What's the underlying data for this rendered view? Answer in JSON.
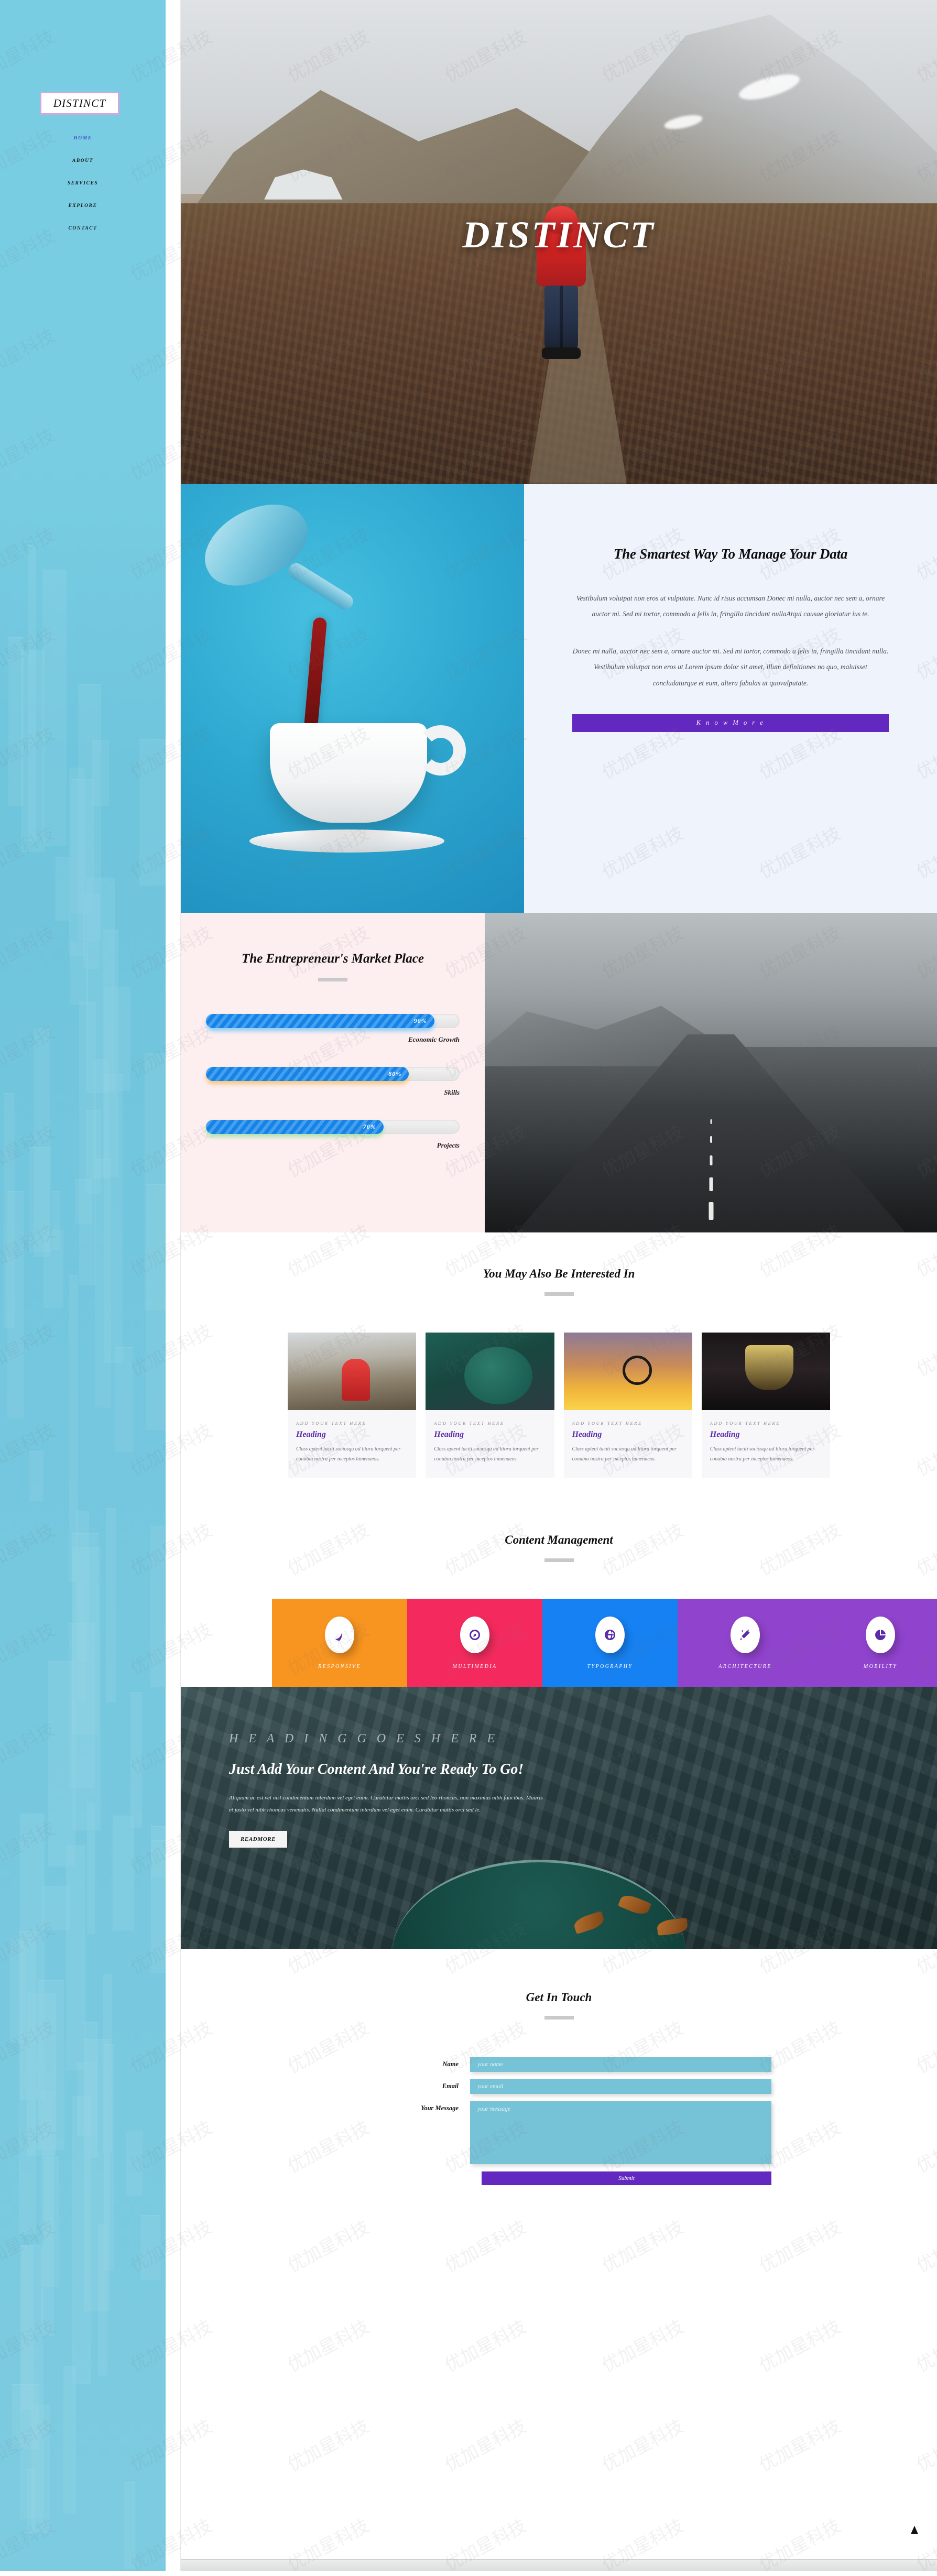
{
  "sidebar": {
    "logo": "DISTINCT",
    "nav": [
      {
        "label": "HOME",
        "active": true
      },
      {
        "label": "ABOUT",
        "active": false
      },
      {
        "label": "SERVICES",
        "active": false
      },
      {
        "label": "EXPLORE",
        "active": false
      },
      {
        "label": "CONTACT",
        "active": false
      }
    ],
    "bg_color": "#78cde2"
  },
  "hero": {
    "title": "DISTINCT"
  },
  "section_data": {
    "heading": "The Smartest Way To Manage Your Data",
    "paragraph1": "Vestibulum volutpat non eros ut vulputate. Nunc id risus accumsan Donec mi nulla, auctor nec sem a, ornare auctor mi. Sed mi tortor, commodo a felis in, fringilla tincidunt nullaAtqui causae gloriatur ius te.",
    "paragraph2": "Donec mi nulla, auctor nec sem a, ornare auctor mi. Sed mi tortor, commodo a felis in, fringilla tincidunt nulla. Vestibulum volutpat non eros ut Lorem ipsum dolor sit amet, illum definitiones no quo, maluisset concludaturque et eum, altera fabulas ut quovulputate.",
    "button": "K n o w   M o r e",
    "button_color": "#6328c0"
  },
  "market": {
    "heading": "The Entrepreneur's Market Place",
    "bars": [
      {
        "label": "Economic Growth",
        "value": "90%",
        "percent": 90,
        "glow": "#7ec8f5"
      },
      {
        "label": "Skills",
        "value": "80%",
        "percent": 80,
        "glow": "#f5c06a"
      },
      {
        "label": "Projects",
        "value": "70%",
        "percent": 70,
        "glow": "#9fe2a2"
      }
    ],
    "bar_color": "#1484e8",
    "bg_color": "#fdeef0"
  },
  "interested": {
    "heading": "You May Also Be Interested In",
    "cards": [
      {
        "eyebrow": "ADD YOUR TEXT HERE",
        "title": "Heading",
        "body": "Class aptent taciti sociosqu ad litora torquent per conubia nostra per inceptos himenaeos."
      },
      {
        "eyebrow": "ADD YOUR TEXT HERE",
        "title": "Heading",
        "body": "Class aptent taciti sociosqu ad litora torquent per conubia nostra per inceptos himenaeos."
      },
      {
        "eyebrow": "ADD YOUR TEXT HERE",
        "title": "Heading",
        "body": "Class aptent taciti sociosqu ad litora torquent per conubia nostra per inceptos himenaeos."
      },
      {
        "eyebrow": "ADD YOUR TEXT HERE",
        "title": "Heading",
        "body": "Class aptent taciti sociosqu ad litora torquent per conubia nostra per inceptos himenaeos."
      }
    ],
    "heading_color": "#5b2ca8"
  },
  "content_management": {
    "heading": "Content Management",
    "tiles": [
      {
        "label": "RESPONSIVE",
        "icon": "wave-icon",
        "color": "#f89420"
      },
      {
        "label": "MULTIMEDIA",
        "icon": "compass-icon",
        "color": "#f42a5e"
      },
      {
        "label": "TYPOGRAPHY",
        "icon": "globe-icon",
        "color": "#1581f2"
      },
      {
        "label": "ARCHITECTURE",
        "icon": "magic-wand-icon",
        "color": "#9043cd"
      },
      {
        "label": "MOBILITY",
        "icon": "pie-chart-icon",
        "color": "#9043cd"
      }
    ]
  },
  "banner": {
    "eyebrow": "H E A D I N G   G O E S   H E R E",
    "heading": "Just Add Your Content And You're Ready To Go!",
    "body": "Aliquam ac est vel nisl condimentum interdum vel eget enim. Curabitur mattis orci sed leo rhoncus, non maximus nibh faucibus. Mauris et justo vel nibh rhoncus venenatis. Nullal condimentum interdum vel eget enim. Curabitur mattis orci sed le.",
    "button": "READMORE"
  },
  "contact": {
    "heading": "Get In Touch",
    "fields": [
      {
        "label": "Name",
        "placeholder": "your name",
        "value": "",
        "type": "input"
      },
      {
        "label": "Email",
        "placeholder": "your email",
        "value": "",
        "type": "input"
      },
      {
        "label": "Your Message",
        "placeholder": "your message",
        "value": "",
        "type": "textarea"
      }
    ],
    "submit": "Submit",
    "field_color": "#76c2d6",
    "submit_color": "#6328c0"
  }
}
